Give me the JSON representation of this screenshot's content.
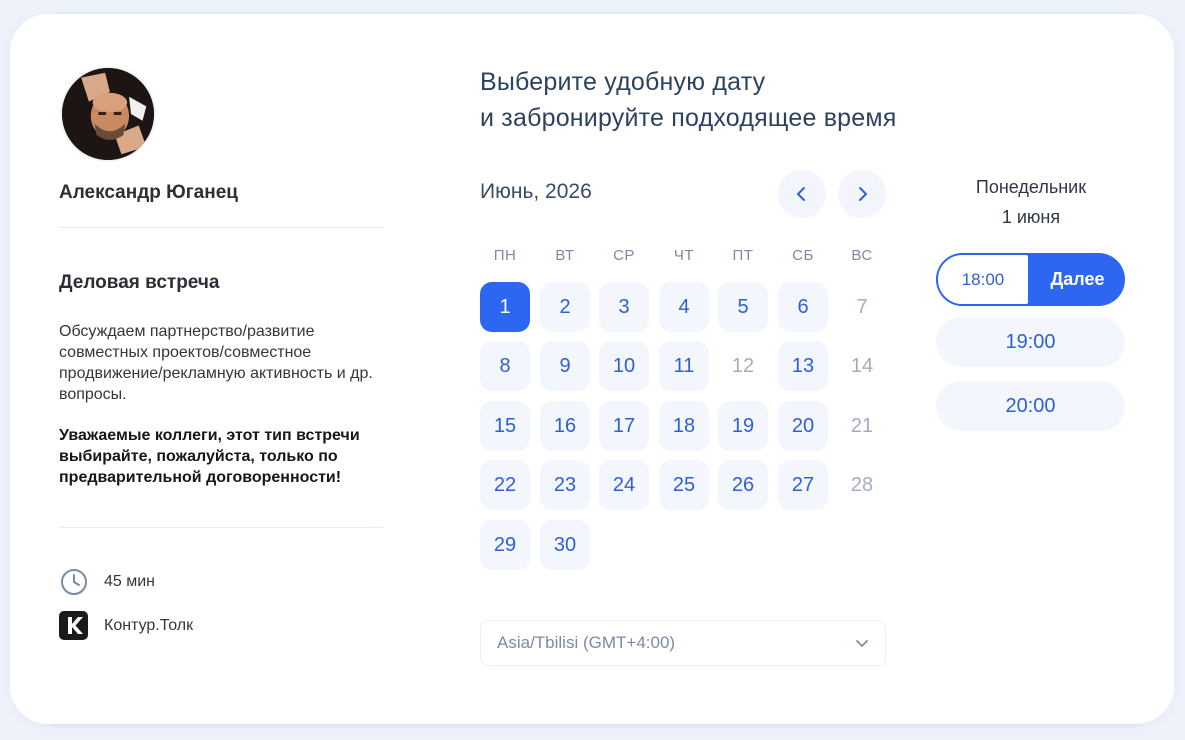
{
  "host": {
    "name": "Александр Юганец"
  },
  "meeting": {
    "title": "Деловая встреча",
    "description": "Обсуждаем партнерство/развитие совместных проектов/совместное продвижение/рекламную активность и др. вопросы.",
    "note": "Уважаемые коллеги, этот тип встречи выбирайте, пожалуйста, только по предварительной договоренности!",
    "duration": "45 мин",
    "platform": "Контур.Толк"
  },
  "heading": {
    "line1": "Выберите удобную дату",
    "line2": "и забронируйте подходящее время"
  },
  "calendar": {
    "month": "Июнь, 2026",
    "weekdays": [
      "ПН",
      "ВТ",
      "СР",
      "ЧТ",
      "ПТ",
      "СБ",
      "ВС"
    ],
    "days": [
      {
        "n": "1",
        "state": "selected"
      },
      {
        "n": "2",
        "state": "available"
      },
      {
        "n": "3",
        "state": "available"
      },
      {
        "n": "4",
        "state": "available"
      },
      {
        "n": "5",
        "state": "available"
      },
      {
        "n": "6",
        "state": "available"
      },
      {
        "n": "7",
        "state": "disabled"
      },
      {
        "n": "8",
        "state": "available"
      },
      {
        "n": "9",
        "state": "available"
      },
      {
        "n": "10",
        "state": "available"
      },
      {
        "n": "11",
        "state": "available"
      },
      {
        "n": "12",
        "state": "disabled"
      },
      {
        "n": "13",
        "state": "available"
      },
      {
        "n": "14",
        "state": "disabled"
      },
      {
        "n": "15",
        "state": "available"
      },
      {
        "n": "16",
        "state": "available"
      },
      {
        "n": "17",
        "state": "available"
      },
      {
        "n": "18",
        "state": "available"
      },
      {
        "n": "19",
        "state": "available"
      },
      {
        "n": "20",
        "state": "available"
      },
      {
        "n": "21",
        "state": "disabled"
      },
      {
        "n": "22",
        "state": "available"
      },
      {
        "n": "23",
        "state": "available"
      },
      {
        "n": "24",
        "state": "available"
      },
      {
        "n": "25",
        "state": "available"
      },
      {
        "n": "26",
        "state": "available"
      },
      {
        "n": "27",
        "state": "available"
      },
      {
        "n": "28",
        "state": "disabled"
      },
      {
        "n": "29",
        "state": "available"
      },
      {
        "n": "30",
        "state": "available"
      }
    ],
    "timezone": "Asia/Tbilisi (GMT+4:00)"
  },
  "times": {
    "weekday": "Понедельник",
    "date": "1 июня",
    "selected": "18:00",
    "next_label": "Далее",
    "slots": [
      "19:00",
      "20:00"
    ]
  },
  "colors": {
    "accent": "#2d66f0",
    "day_bg": "#f3f6fc",
    "disabled_text": "#a3adbe"
  }
}
